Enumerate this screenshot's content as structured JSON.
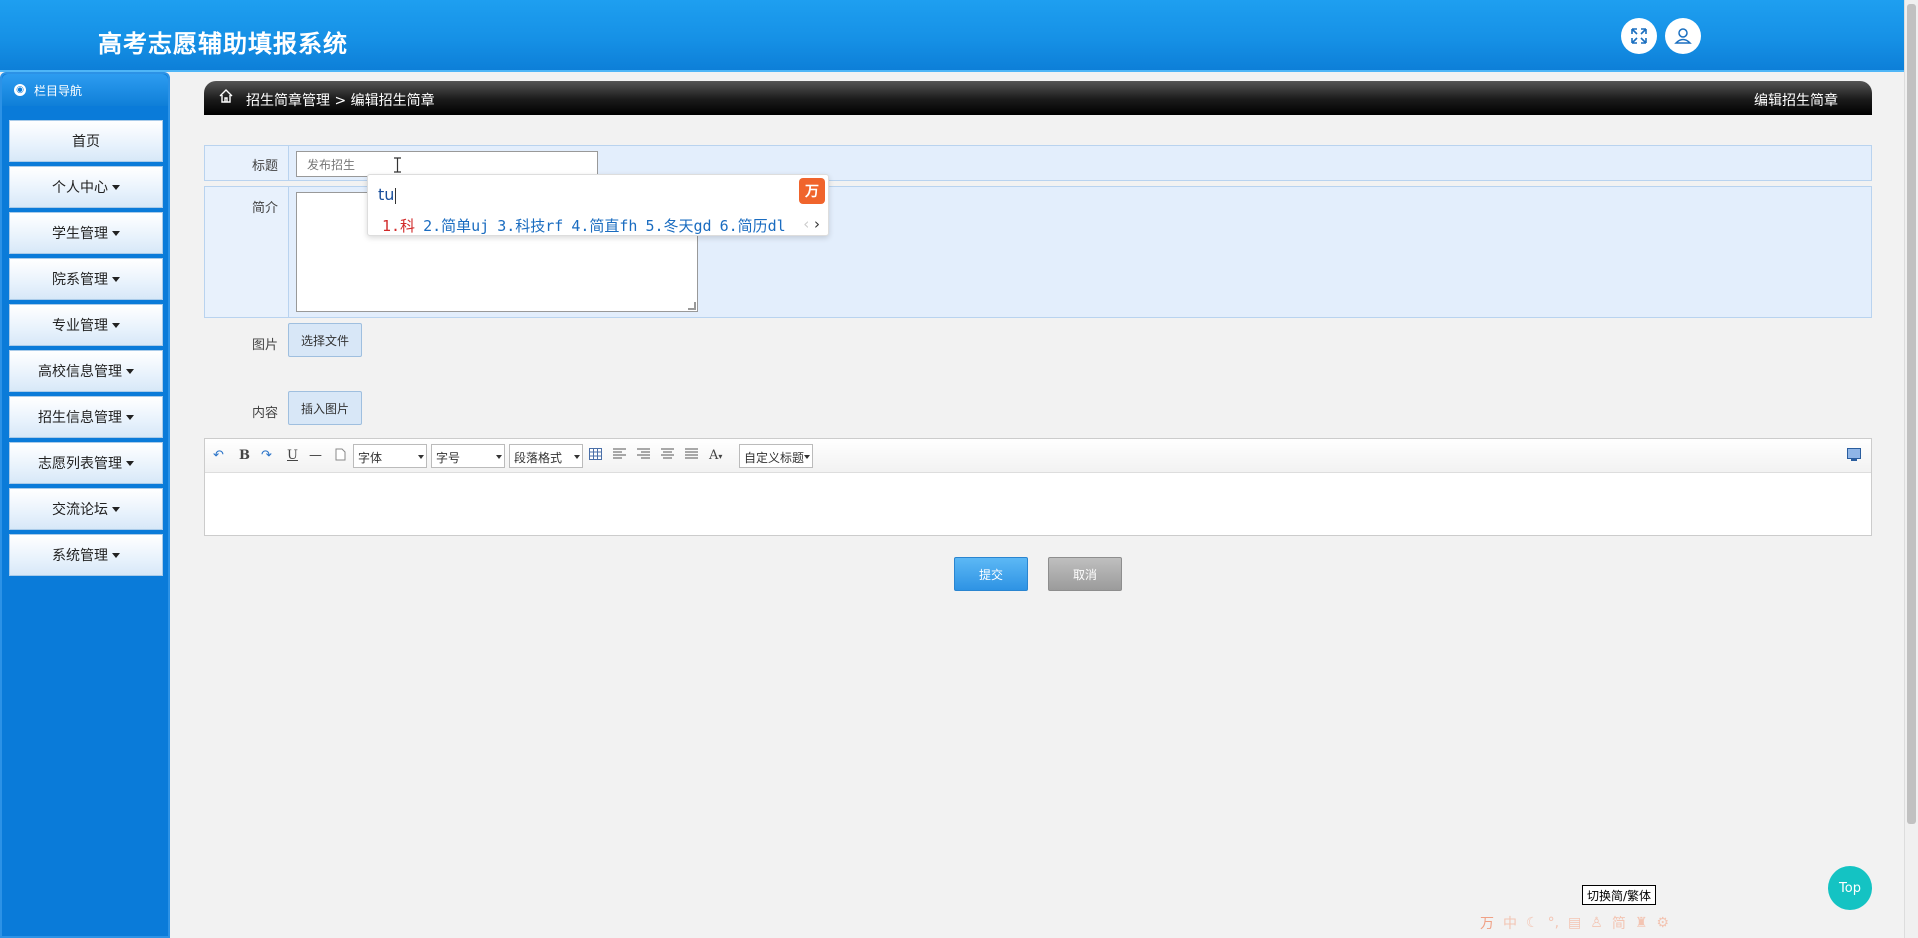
{
  "header": {
    "title": "高考志愿辅助填报系统"
  },
  "sidebar": {
    "nav_title": "栏目导航",
    "items": [
      {
        "label": "首页",
        "dropdown": false
      },
      {
        "label": "个人中心",
        "dropdown": true
      },
      {
        "label": "学生管理",
        "dropdown": true
      },
      {
        "label": "院系管理",
        "dropdown": true
      },
      {
        "label": "专业管理",
        "dropdown": true
      },
      {
        "label": "高校信息管理",
        "dropdown": true
      },
      {
        "label": "招生信息管理",
        "dropdown": true
      },
      {
        "label": "志愿列表管理",
        "dropdown": true
      },
      {
        "label": "交流论坛",
        "dropdown": true
      },
      {
        "label": "系统管理",
        "dropdown": true
      }
    ]
  },
  "breadcrumb": {
    "path": "招生简章管理 > 编辑招生简章",
    "right_title": "编辑招生简章"
  },
  "form": {
    "title_label": "标题",
    "title_value": "发布招生",
    "intro_label": "简介",
    "intro_value": "",
    "image_label": "图片",
    "choose_file": "选择文件",
    "content_label": "内容",
    "insert_image": "插入图片",
    "submit": "提交",
    "cancel": "取消"
  },
  "editor": {
    "font_select": "字体",
    "size_select": "字号",
    "paragraph_select": "段落格式",
    "custom_title_select": "自定义标题",
    "bold": "B",
    "underline": "U",
    "font_color": "A"
  },
  "ime": {
    "pinyin": "tu",
    "candidates": [
      "1.科",
      "2.简单uj",
      "3.科技rf",
      "4.简直fh",
      "5.冬天gd",
      "6.简历dl"
    ],
    "logo_char": "万"
  },
  "floating": {
    "top_button": "Top",
    "tooltip": "切换简/繁体",
    "ime_bar": [
      "中",
      "简"
    ]
  }
}
